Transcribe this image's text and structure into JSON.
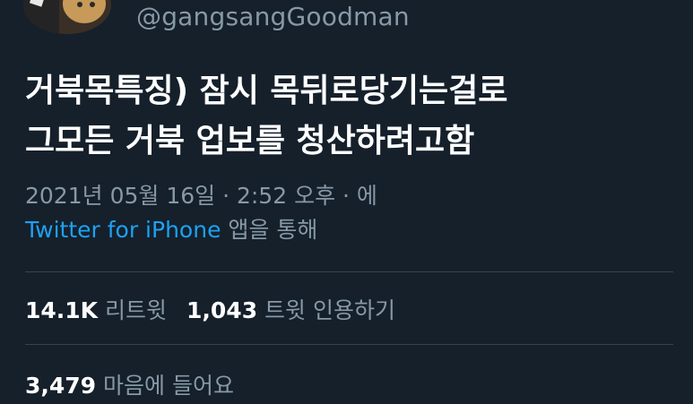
{
  "profile": {
    "handle": "@gangsangGoodman"
  },
  "tweet": {
    "text_lines": [
      "거북목특징) 잠시 목뒤로당기는걸로",
      "그모든 거북 업보를 청산하려고함"
    ],
    "timestamp": "2021년 05월 16일 · 2:52 오후 · 에",
    "source_link": "Twitter for iPhone",
    "source_suffix": " 앱을 통해"
  },
  "stats": {
    "retweets_count": "14.1K",
    "retweets_label": " 리트윗",
    "quotes_count": "1,043",
    "quotes_label": " 트윗 인용하기",
    "likes_count": "3,479",
    "likes_label": " 마음에 들어요"
  },
  "colors": {
    "background": "#15202b",
    "text_primary": "#ffffff",
    "text_secondary": "#8899a6",
    "link": "#1da1f2",
    "divider": "#38444d"
  }
}
